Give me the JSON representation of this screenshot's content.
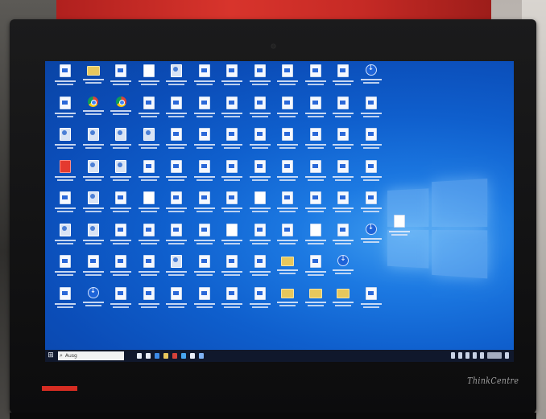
{
  "monitor": {
    "brand": "ThinkCentre"
  },
  "screen": {
    "background": "#0f5fcd",
    "accent": "#3f9df0"
  },
  "desktop": {
    "icons": [
      "doc",
      "folder",
      "doc",
      "blank",
      "app",
      "doc",
      "doc",
      "doc",
      "doc",
      "doc",
      "doc",
      "download",
      "doc",
      "chrome",
      "chrome",
      "doc",
      "doc",
      "doc",
      "doc",
      "doc",
      "doc",
      "doc",
      "doc",
      "doc",
      "app",
      "app",
      "app",
      "app",
      "doc",
      "doc",
      "doc",
      "doc",
      "doc",
      "doc",
      "doc",
      "doc",
      "pdf",
      "app",
      "app",
      "doc",
      "doc",
      "doc",
      "doc",
      "doc",
      "doc",
      "doc",
      "doc",
      "doc",
      "doc",
      "app",
      "doc",
      "blank",
      "doc",
      "doc",
      "doc",
      "blank",
      "doc",
      "doc",
      "doc",
      "doc",
      "app",
      "app",
      "doc",
      "doc",
      "doc",
      "doc",
      "blank",
      "doc",
      "doc",
      "blank",
      "doc",
      "download",
      "doc",
      "doc",
      "doc",
      "doc",
      "app",
      "doc",
      "doc",
      "doc",
      "folder",
      "doc",
      "download",
      "empty",
      "doc",
      "download",
      "doc",
      "doc",
      "doc",
      "doc",
      "doc",
      "doc",
      "folder",
      "folder",
      "folder",
      "doc"
    ]
  },
  "taskbar": {
    "search_placeholder": "Ausg",
    "pinned_colors": [
      "#e9eef7",
      "#e9eef7",
      "#3c8be8",
      "#e7c75c",
      "#d6423a",
      "#48a6f0",
      "#e9eef7",
      "#7fb3f5"
    ]
  }
}
